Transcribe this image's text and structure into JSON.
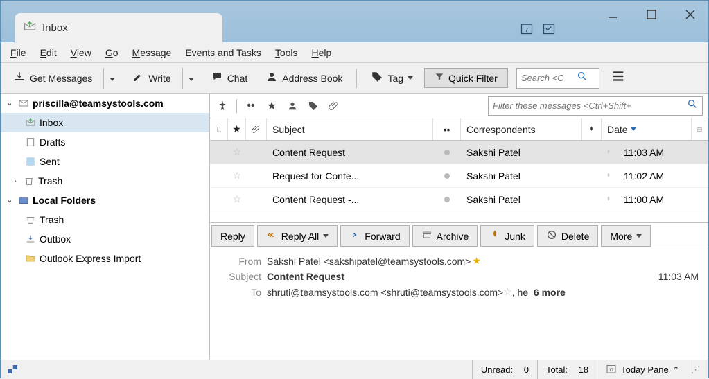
{
  "window": {
    "tab_title": "Inbox"
  },
  "menubar": {
    "file": "File",
    "edit": "Edit",
    "view": "View",
    "go": "Go",
    "message": "Message",
    "events": "Events and Tasks",
    "tools": "Tools",
    "help": "Help"
  },
  "toolbar": {
    "get_messages": "Get Messages",
    "write": "Write",
    "chat": "Chat",
    "address_book": "Address Book",
    "tag": "Tag",
    "quick_filter": "Quick Filter",
    "search_placeholder": "Search <C"
  },
  "sidebar": {
    "account": "priscilla@teamsystools.com",
    "inbox": "Inbox",
    "drafts": "Drafts",
    "sent": "Sent",
    "trash": "Trash",
    "local_folders": "Local Folders",
    "local_trash": "Trash",
    "outbox": "Outbox",
    "outlook_import": "Outlook Express Import"
  },
  "filterbar": {
    "placeholder": "Filter these messages <Ctrl+Shift+"
  },
  "columns": {
    "subject": "Subject",
    "correspondents": "Correspondents",
    "date": "Date"
  },
  "messages": [
    {
      "subject": "Content Request",
      "correspondent": "Sakshi Patel",
      "date": "11:03 AM",
      "selected": true
    },
    {
      "subject": "Request for Conte...",
      "correspondent": "Sakshi Patel",
      "date": "11:02 AM",
      "selected": false
    },
    {
      "subject": "Content Request -...",
      "correspondent": "Sakshi Patel",
      "date": "11:00 AM",
      "selected": false
    }
  ],
  "preview_toolbar": {
    "reply": "Reply",
    "reply_all": "Reply All",
    "forward": "Forward",
    "archive": "Archive",
    "junk": "Junk",
    "delete": "Delete",
    "more": "More"
  },
  "preview": {
    "from_label": "From",
    "from_value": "Sakshi Patel <sakshipatel@teamsystools.com>",
    "subject_label": "Subject",
    "subject_value": "Content Request",
    "time": "11:03 AM",
    "to_label": "To",
    "to_value": "shruti@teamsystools.com <shruti@teamsystools.com>",
    "to_suffix": ", he",
    "more_count": "6 more"
  },
  "statusbar": {
    "unread_label": "Unread:",
    "unread_value": "0",
    "total_label": "Total:",
    "total_value": "18",
    "today_pane": "Today Pane"
  }
}
